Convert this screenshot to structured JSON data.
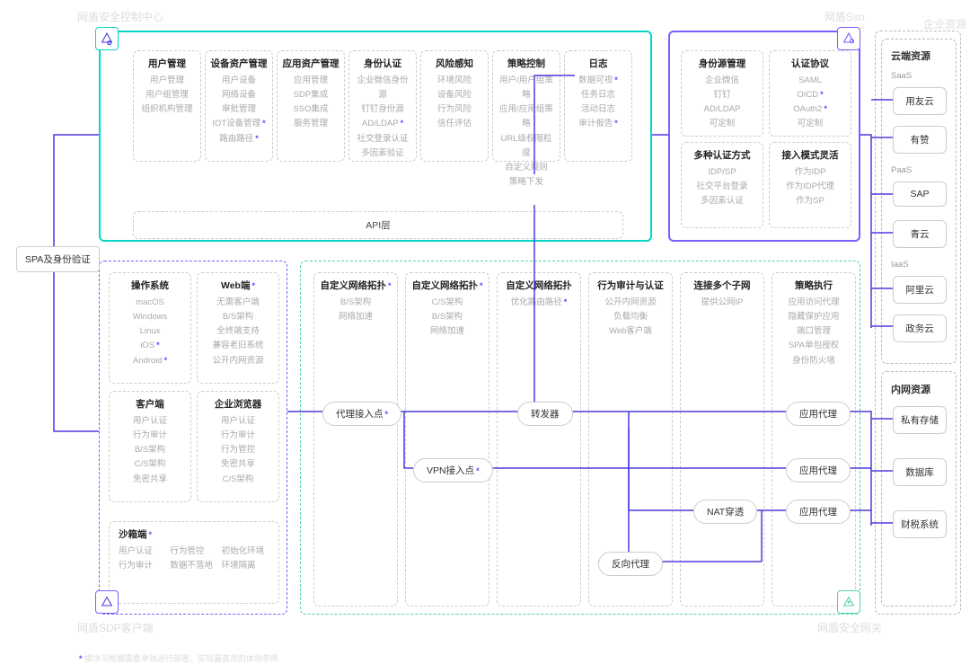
{
  "labels": {
    "top_left": "网盾安全控制中心",
    "top_right_sso": "网盾Sso",
    "top_right_corp": "企业资源",
    "bottom_left": "网盾SDP客户端",
    "bottom_right": "网盾安全网关",
    "footnote_prefix": "*",
    "footnote": "模块可根据需要单独进行部署，实现最直观的体验参照"
  },
  "left_pill": "SPA及身份验证",
  "top_panel": {
    "cards": [
      {
        "title": "用户管理",
        "items": [
          [
            "用户管理",
            false
          ],
          [
            "用户组管理",
            false
          ],
          [
            "组织机构管理",
            false
          ]
        ]
      },
      {
        "title": "设备资产管理",
        "items": [
          [
            "用户设备",
            false
          ],
          [
            "网络设备",
            false
          ],
          [
            "审批管理",
            false
          ],
          [
            "IOT设备管理",
            true
          ],
          [
            "路由路径",
            true
          ]
        ]
      },
      {
        "title": "应用资产管理",
        "items": [
          [
            "应用管理",
            false
          ],
          [
            "SDP集成",
            false
          ],
          [
            "SSO集成",
            false
          ],
          [
            "服务管理",
            false
          ]
        ]
      },
      {
        "title": "身份认证",
        "items": [
          [
            "企业微信身份源",
            false
          ],
          [
            "钉钉身份源",
            false
          ],
          [
            "AD/LDAP",
            true
          ],
          [
            "社交登录认证",
            false
          ],
          [
            "多因素验证",
            false
          ]
        ]
      },
      {
        "title": "风险感知",
        "items": [
          [
            "环境风险",
            false
          ],
          [
            "设备风险",
            false
          ],
          [
            "行为风险",
            false
          ],
          [
            "信任评估",
            false
          ]
        ]
      },
      {
        "title": "策略控制",
        "items": [
          [
            "用户/用户组策略",
            false
          ],
          [
            "应用/应用组策略",
            false
          ],
          [
            "URL级权限粒度",
            false
          ],
          [
            "自定义规则",
            false
          ],
          [
            "策略下发",
            false
          ]
        ]
      },
      {
        "title": "日志",
        "items": [
          [
            "数据可视",
            true
          ],
          [
            "任务日志",
            false
          ],
          [
            "活动日志",
            false
          ],
          [
            "审计报告",
            true
          ]
        ]
      }
    ],
    "api": "API层"
  },
  "sso_panel": {
    "cards": [
      {
        "title": "身份源管理",
        "items": [
          [
            "企业微信",
            false
          ],
          [
            "钉钉",
            false
          ],
          [
            "AD/LDAP",
            false
          ],
          [
            "可定制",
            false
          ]
        ]
      },
      {
        "title": "认证协议",
        "items": [
          [
            "SAML",
            false
          ],
          [
            "OICD",
            true
          ],
          [
            "OAuth2",
            true
          ],
          [
            "可定制",
            false
          ]
        ]
      },
      {
        "title": "多种认证方式",
        "items": [
          [
            "IDP/SP",
            false
          ],
          [
            "社交平台登录",
            false
          ],
          [
            "多因素认证",
            false
          ]
        ]
      },
      {
        "title": "接入模式灵活",
        "items": [
          [
            "作为IDP",
            false
          ],
          [
            "作为IDP代理",
            false
          ],
          [
            "作为SP",
            false
          ]
        ]
      }
    ]
  },
  "bottom_left_panel": {
    "cards": [
      {
        "title": "操作系统",
        "star": false,
        "items": [
          [
            "macOS",
            false
          ],
          [
            "Windows",
            false
          ],
          [
            "Linux",
            false
          ],
          [
            "iOS",
            true
          ],
          [
            "Android",
            true
          ]
        ]
      },
      {
        "title": "Web端",
        "star": true,
        "items": [
          [
            "无需客户端",
            false
          ],
          [
            "B/S架构",
            false
          ],
          [
            "全终端支持",
            false
          ],
          [
            "兼容老旧系统",
            false
          ],
          [
            "公开内网资源",
            false
          ]
        ]
      },
      {
        "title": "客户端",
        "star": false,
        "items": [
          [
            "用户认证",
            false
          ],
          [
            "行为审计",
            false
          ],
          [
            "B/S架构",
            false
          ],
          [
            "C/S架构",
            false
          ],
          [
            "免密共享",
            false
          ]
        ]
      },
      {
        "title": "企业浏览器",
        "star": false,
        "items": [
          [
            "用户认证",
            false
          ],
          [
            "行为审计",
            false
          ],
          [
            "行为管控",
            false
          ],
          [
            "免密共享",
            false
          ],
          [
            "C/S架构",
            false
          ]
        ]
      }
    ],
    "sandbox": {
      "title": "沙箱端",
      "items": [
        [
          "用户认证",
          false
        ],
        [
          "行为管控",
          false
        ],
        [
          "初始化环境",
          false
        ],
        [
          "行为审计",
          false
        ],
        [
          "数据不落地",
          false
        ],
        [
          "环境隔离",
          false
        ]
      ]
    }
  },
  "gateway_panel": {
    "cols": [
      {
        "title": "自定义网络拓扑",
        "star": true,
        "items": [
          [
            "B/S架构",
            false
          ],
          [
            "网络加速",
            false
          ]
        ]
      },
      {
        "title": "自定义网络拓扑",
        "star": true,
        "items": [
          [
            "C/S架构",
            false
          ],
          [
            "B/S架构",
            false
          ],
          [
            "网络加速",
            false
          ]
        ]
      },
      {
        "title": "自定义网络拓扑",
        "star": false,
        "items": [
          [
            "优化路由路径",
            true
          ]
        ]
      },
      {
        "title": "行为审计与认证",
        "star": false,
        "items": [
          [
            "公开内网资源",
            false
          ],
          [
            "负载均衡",
            false
          ],
          [
            "Web客户端",
            false
          ]
        ]
      },
      {
        "title": "连接多个子网",
        "star": false,
        "items": [
          [
            "提供公网IP",
            false
          ]
        ]
      },
      {
        "title": "策略执行",
        "star": false,
        "items": [
          [
            "应用访问代理",
            false
          ],
          [
            "隐藏保护应用",
            false
          ],
          [
            "端口管理",
            false
          ],
          [
            "SPA单包授权",
            false
          ],
          [
            "身份防火墙",
            false
          ]
        ]
      }
    ],
    "pills": {
      "proxy_entry": "代理接入点",
      "vpn_entry": "VPN接入点",
      "forwarder": "转发器",
      "nat": "NAT穿透",
      "reverse": "反向代理",
      "app_proxy1": "应用代理",
      "app_proxy2": "应用代理",
      "app_proxy3": "应用代理"
    }
  },
  "resources": {
    "cloud_header": "云端资源",
    "saas_label": "SaaS",
    "saas": [
      "用友云",
      "有赞"
    ],
    "paas_label": "PaaS",
    "paas": [
      "SAP",
      "青云"
    ],
    "iaas_label": "IaaS",
    "iaas": [
      "阿里云",
      "政务云"
    ],
    "intranet_header": "内网资源",
    "intranet": [
      "私有存储",
      "数据库",
      "财税系统"
    ]
  }
}
